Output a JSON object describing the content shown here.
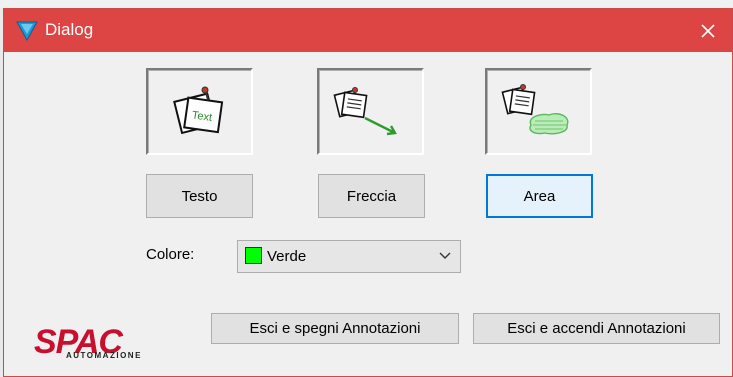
{
  "window": {
    "title": "Dialog",
    "titlebar_color": "#dd4444",
    "title_icon": "funnel-logo-icon",
    "close_icon": "close-icon"
  },
  "tools": [
    {
      "id": "testo",
      "icon": "note-text-icon",
      "icon_text": "Text",
      "label": "Testo",
      "focused": false
    },
    {
      "id": "freccia",
      "icon": "note-arrow-icon",
      "label": "Freccia",
      "focused": false
    },
    {
      "id": "area",
      "icon": "note-area-icon",
      "label": "Area",
      "focused": true
    }
  ],
  "color_picker": {
    "label": "Colore:",
    "selected": "Verde",
    "swatch_color": "#00ff00",
    "arrow_icon": "chevron-down-icon"
  },
  "footer": {
    "logo_text": "SPAC",
    "logo_subtext": "AUTOMAZIONE",
    "logo_color": "#c8102e",
    "exit_off_label": "Esci e spegni Annotazioni",
    "exit_on_label": "Esci e accendi Annotazioni"
  }
}
